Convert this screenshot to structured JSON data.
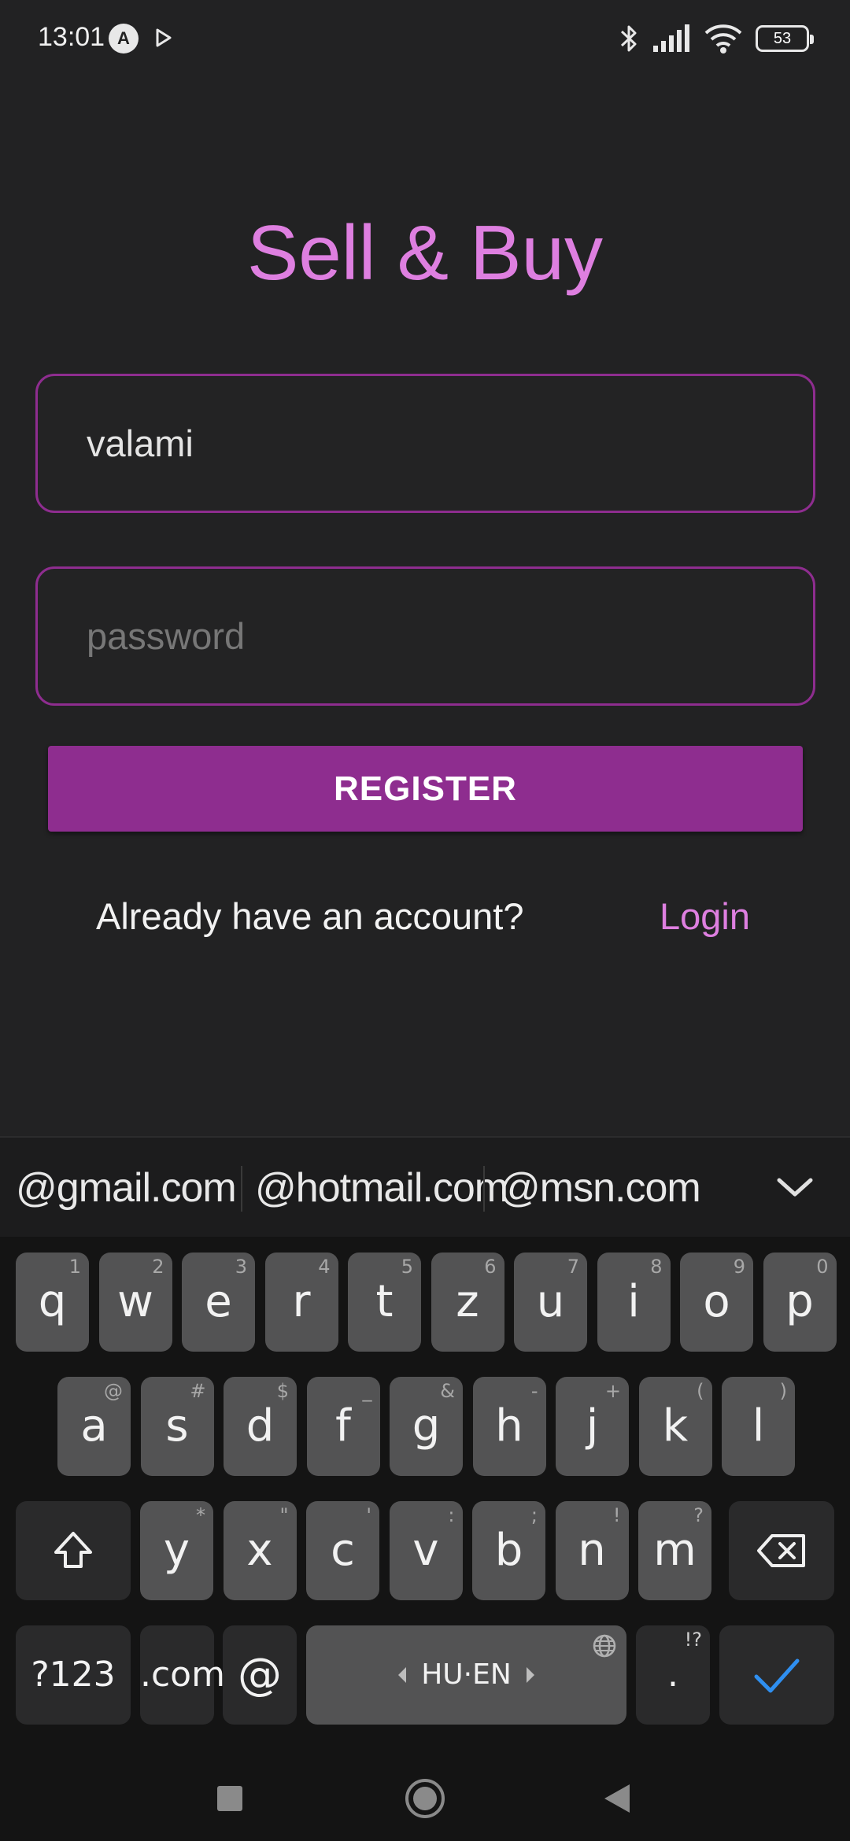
{
  "status": {
    "time": "13:01",
    "app_badge": "A",
    "battery": "53"
  },
  "app": {
    "title": "Sell & Buy",
    "username_value": "valami",
    "password_placeholder": "password",
    "register_label": "REGISTER",
    "already_text": "Already have an account?",
    "login_label": "Login",
    "accent_color": "#de7fe0",
    "button_color": "#8e2d8f"
  },
  "keyboard": {
    "suggestions": [
      "@gmail.com",
      "@hotmail.com",
      "@msn.com"
    ],
    "row1": [
      {
        "k": "q",
        "h": "1"
      },
      {
        "k": "w",
        "h": "2"
      },
      {
        "k": "e",
        "h": "3"
      },
      {
        "k": "r",
        "h": "4"
      },
      {
        "k": "t",
        "h": "5"
      },
      {
        "k": "z",
        "h": "6"
      },
      {
        "k": "u",
        "h": "7"
      },
      {
        "k": "i",
        "h": "8"
      },
      {
        "k": "o",
        "h": "9"
      },
      {
        "k": "p",
        "h": "0"
      }
    ],
    "row2": [
      {
        "k": "a",
        "h": "@"
      },
      {
        "k": "s",
        "h": "#"
      },
      {
        "k": "d",
        "h": "$"
      },
      {
        "k": "f",
        "h": "_"
      },
      {
        "k": "g",
        "h": "&"
      },
      {
        "k": "h",
        "h": "-"
      },
      {
        "k": "j",
        "h": "+"
      },
      {
        "k": "k",
        "h": "("
      },
      {
        "k": "l",
        "h": ")"
      }
    ],
    "row3": [
      {
        "k": "y",
        "h": "*"
      },
      {
        "k": "x",
        "h": "\""
      },
      {
        "k": "c",
        "h": "'"
      },
      {
        "k": "v",
        "h": ":"
      },
      {
        "k": "b",
        "h": ";"
      },
      {
        "k": "n",
        "h": "!"
      },
      {
        "k": "m",
        "h": "?"
      }
    ],
    "symbols_label": "?123",
    "com_label": ".com",
    "at_label": "@",
    "space_label": "HU·EN",
    "period_label": ".",
    "period_hint": "!?",
    "enter_color": "#2f8ff0"
  }
}
